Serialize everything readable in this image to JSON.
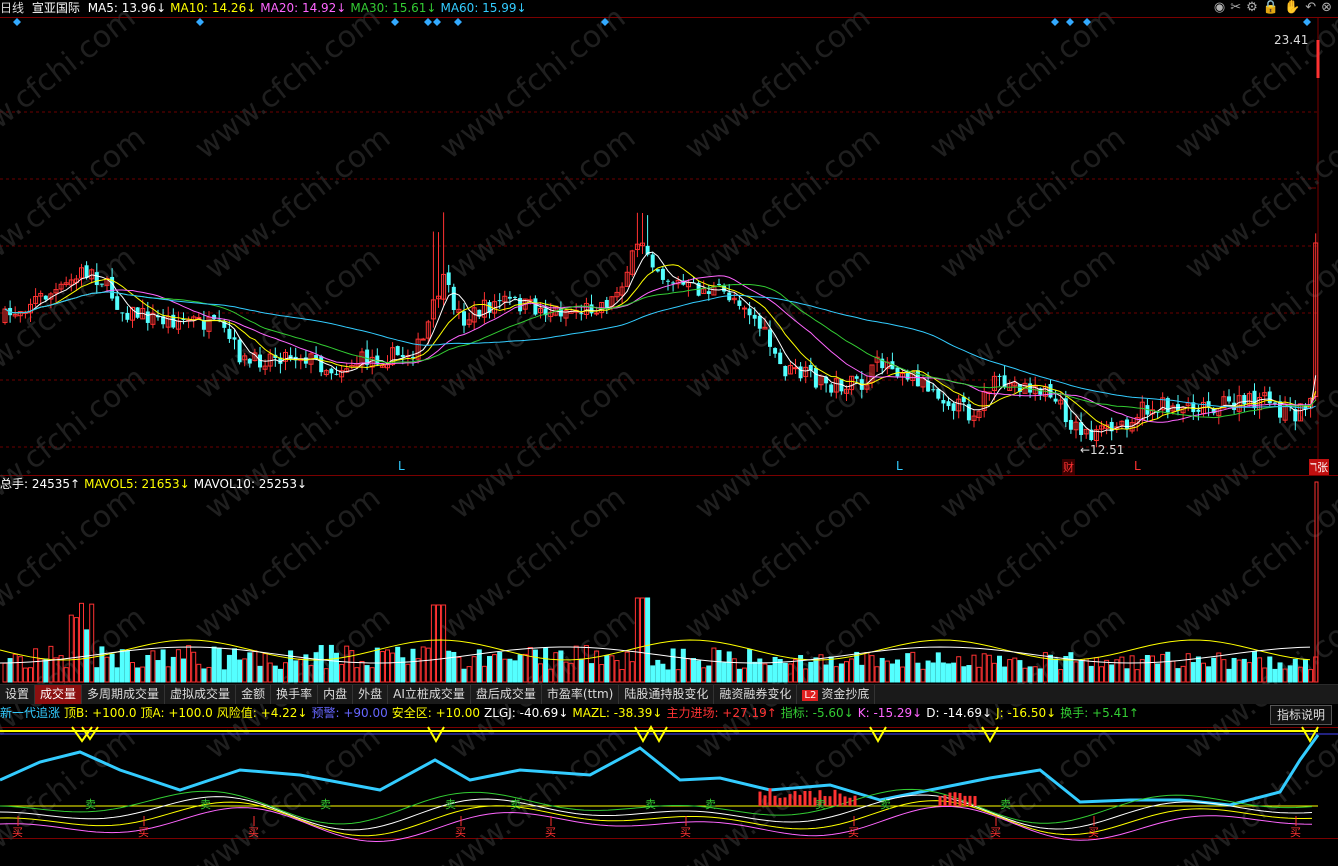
{
  "top_legend": {
    "period": "日线",
    "stock_name": "宣亚国际",
    "ma": [
      {
        "label": "MA5: 13.96",
        "arrow": "↓",
        "color": "#ffffff"
      },
      {
        "label": "MA10: 14.26",
        "arrow": "↓",
        "color": "#ffff00"
      },
      {
        "label": "MA20: 14.92",
        "arrow": "↓",
        "color": "#ff66ff"
      },
      {
        "label": "MA30: 15.61",
        "arrow": "↓",
        "color": "#33cc33"
      },
      {
        "label": "MA60: 15.99",
        "arrow": "↓",
        "color": "#33ccff"
      }
    ]
  },
  "toolbar_icons": [
    "eye-icon",
    "scissors-icon",
    "settings-icon",
    "lock-icon",
    "hand-icon",
    "undo-icon",
    "close-circle-icon"
  ],
  "toolbar_glyphs": [
    "◉",
    "✂",
    "⚙",
    "🔒",
    "✋",
    "↶",
    "⊗"
  ],
  "price_chart": {
    "high_label": "23.41",
    "low_label": "←12.51",
    "markers": {
      "L1": "L",
      "L2": "L",
      "L3": "L",
      "cai": "财",
      "zhang": "ℸ张"
    }
  },
  "volume_legend": [
    {
      "label": "总手: 24535",
      "arrow": "↑",
      "color": "#ffffff"
    },
    {
      "label": "MAVOL5: 21653",
      "arrow": "↓",
      "color": "#ffff00"
    },
    {
      "label": "MAVOL10: 25253",
      "arrow": "↓",
      "color": "#ffffff"
    }
  ],
  "tabs": [
    {
      "label": "设置",
      "active": false
    },
    {
      "label": "成交量",
      "active": true
    },
    {
      "label": "多周期成交量",
      "active": false
    },
    {
      "label": "虚拟成交量",
      "active": false
    },
    {
      "label": "金额",
      "active": false
    },
    {
      "label": "换手率",
      "active": false
    },
    {
      "label": "内盘",
      "active": false
    },
    {
      "label": "外盘",
      "active": false
    },
    {
      "label": "AI立桩成交量",
      "active": false
    },
    {
      "label": "盘后成交量",
      "active": false
    },
    {
      "label": "市盈率(ttm)",
      "active": false
    },
    {
      "label": "陆股通持股变化",
      "active": false
    },
    {
      "label": "融资融券变化",
      "active": false
    }
  ],
  "tab_l2": {
    "badge": "L2",
    "label": "资金抄底"
  },
  "indicator_legend": [
    {
      "label": "新一代追涨",
      "arrow": "",
      "color": "#33ccff"
    },
    {
      "label": "顶B: +100.0",
      "arrow": "",
      "color": "#ffff00"
    },
    {
      "label": "顶A: +100.0",
      "arrow": "",
      "color": "#ffff00"
    },
    {
      "label": "风险值: +4.22",
      "arrow": "↓",
      "color": "#ffff00"
    },
    {
      "label": "预警: +90.00",
      "arrow": "",
      "color": "#6666ff"
    },
    {
      "label": "安全区: +10.00",
      "arrow": "",
      "color": "#ffff00"
    },
    {
      "label": "ZLGJ: -40.69",
      "arrow": "↓",
      "color": "#ffffff"
    },
    {
      "label": "MAZL: -38.39",
      "arrow": "↓",
      "color": "#ffff00"
    },
    {
      "label": "主力进场: +27.19",
      "arrow": "↑",
      "color": "#ff3333"
    },
    {
      "label": "指标: -5.60",
      "arrow": "↓",
      "color": "#33cc33"
    },
    {
      "label": "K: -15.29",
      "arrow": "↓",
      "color": "#ff66ff"
    },
    {
      "label": "D: -14.69",
      "arrow": "↓",
      "color": "#ffffff"
    },
    {
      "label": "J: -16.50",
      "arrow": "↓",
      "color": "#ffff00"
    },
    {
      "label": "换手: +5.41",
      "arrow": "↑",
      "color": "#33cc33"
    }
  ],
  "help_button": "指标说明",
  "signal_labels": {
    "buy": "买",
    "sell": "卖"
  },
  "watermark": "www.cfchi.com",
  "colors": {
    "up": "#ff3232",
    "down": "#54ffff",
    "ma5": "#ffffff",
    "ma10": "#ffff00",
    "ma20": "#ff66ff",
    "ma30": "#33cc33",
    "ma60": "#33ccff",
    "grid": "#6b0000"
  }
}
